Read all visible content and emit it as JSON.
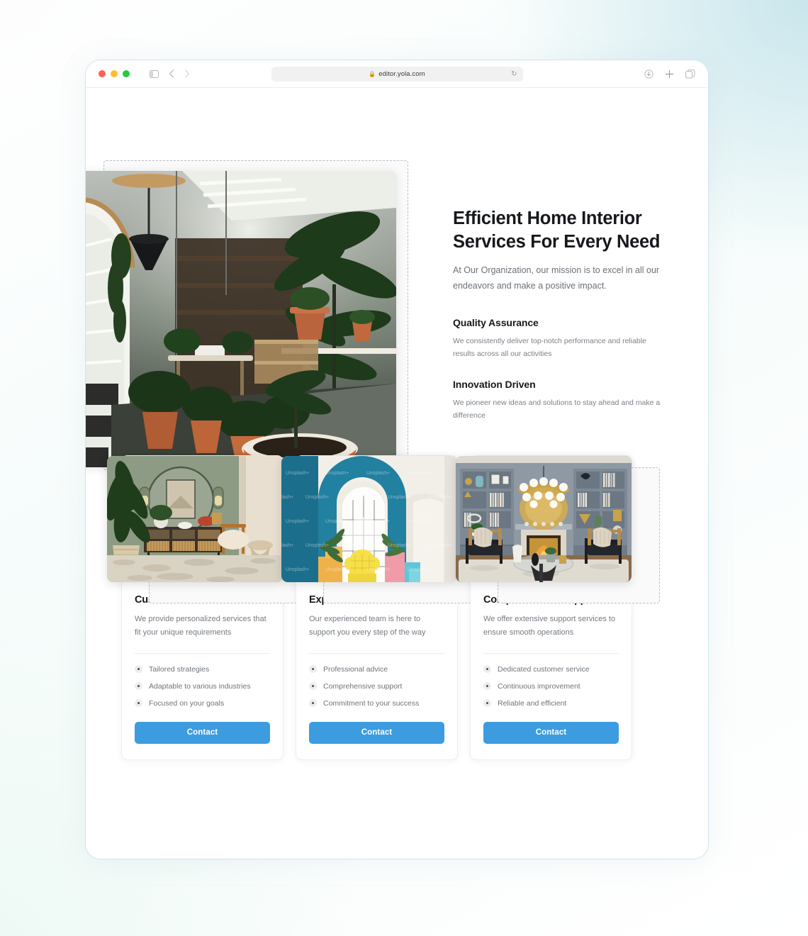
{
  "browser": {
    "url": "editor.yola.com",
    "lock_icon": "lock-icon",
    "traffic_lights": [
      "close-red",
      "minimize-yellow",
      "maximize-green"
    ],
    "left_icons": [
      "sidebar-toggle-icon",
      "back-arrow-icon",
      "forward-arrow-icon"
    ],
    "reader_icon": "reader-mode-icon",
    "reload_icon": "reload-icon",
    "right_icons": [
      "download-icon",
      "new-tab-plus-icon",
      "tab-overview-icon"
    ]
  },
  "hero": {
    "title": "Efficient Home Interior Services For Every Need",
    "subtitle": "At Our Organization, our mission is to excel in all our endeavors and make a positive impact.",
    "features": [
      {
        "heading": "Quality Assurance",
        "body": "We consistently deliver top-notch performance and reliable results across all our activities"
      },
      {
        "heading": "Innovation Driven",
        "body": "We pioneer new ideas and solutions to stay ahead and make a difference"
      }
    ],
    "image_alt": "indoor-plants-staircase-photo"
  },
  "cards": [
    {
      "title": "Custom Solutions",
      "description": "We provide personalized services that fit your unique requirements",
      "bullets": [
        "Tailored strategies",
        "Adaptable to various industries",
        "Focused on your goals"
      ],
      "button_label": "Contact",
      "image_alt": "green-living-room-sideboard-mirror"
    },
    {
      "title": "Expert Guidance",
      "description": "Our experienced team is here to support you every step of the way",
      "bullets": [
        "Professional advice",
        "Comprehensive support",
        "Commitment to your success"
      ],
      "button_label": "Contact",
      "image_alt": "teal-arch-yellow-chair-interior"
    },
    {
      "title": "Comprehensive Support",
      "description": "We offer extensive support services to ensure smooth operations",
      "bullets": [
        "Dedicated customer service",
        "Continuous improvement",
        "Reliable and efficient"
      ],
      "button_label": "Contact",
      "image_alt": "grey-bookshelf-fireplace-living-room"
    }
  ],
  "colors": {
    "button_blue": "#3D9CE0",
    "heading_dark": "#16181C",
    "body_grey": "#6E747A",
    "selection_dash": "#B9BEC4",
    "backdrop_cyan": "#C9E6EC",
    "backdrop_mint": "#EEF9F5"
  }
}
